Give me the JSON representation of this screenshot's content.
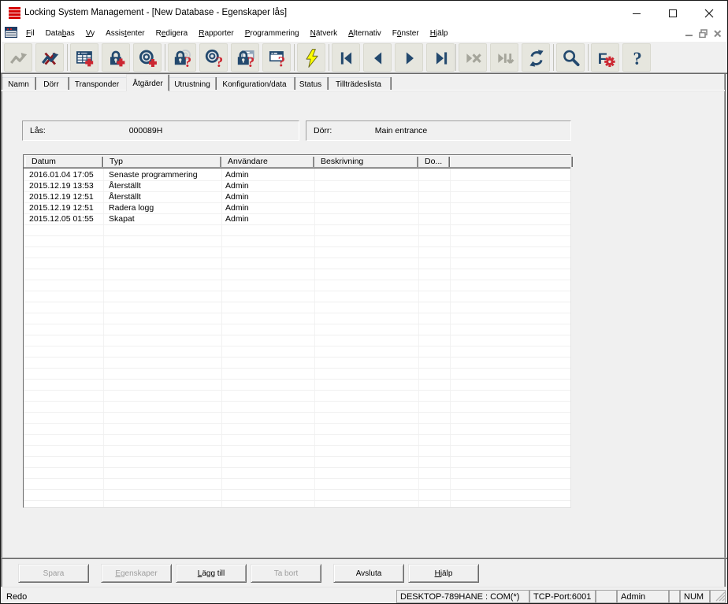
{
  "window": {
    "title": "Locking System Management - [New Database - Egenskaper lås]"
  },
  "menu": [
    {
      "label": "Fil",
      "u": 0
    },
    {
      "label": "Databas",
      "u": 4
    },
    {
      "label": "Vy",
      "u": 0
    },
    {
      "label": "Assistenter",
      "u": 5
    },
    {
      "label": "Redigera",
      "u": 1
    },
    {
      "label": "Rapporter",
      "u": 0
    },
    {
      "label": "Programmering",
      "u": 0
    },
    {
      "label": "Nätverk",
      "u": 0
    },
    {
      "label": "Alternativ",
      "u": 0
    },
    {
      "label": "Fönster",
      "u": 1
    },
    {
      "label": "Hjälp",
      "u": 0
    }
  ],
  "toolbar": [
    {
      "icon": "undo",
      "disabled": true
    },
    {
      "icon": "discard-changes",
      "disabled": false
    },
    {
      "icon": "add-table",
      "disabled": false
    },
    {
      "icon": "add-lock",
      "disabled": false
    },
    {
      "icon": "add-transponder",
      "disabled": false
    },
    {
      "icon": "read-lock",
      "disabled": false
    },
    {
      "icon": "read-transponder",
      "disabled": false
    },
    {
      "icon": "read-lock-data",
      "disabled": false
    },
    {
      "icon": "read-window",
      "disabled": false
    },
    {
      "icon": "program",
      "disabled": false
    },
    {
      "icon": "nav-first",
      "disabled": false
    },
    {
      "icon": "nav-prev",
      "disabled": false
    },
    {
      "icon": "nav-next",
      "disabled": false
    },
    {
      "icon": "nav-last",
      "disabled": false
    },
    {
      "icon": "nav-cancel",
      "disabled": true
    },
    {
      "icon": "nav-commit",
      "disabled": true
    },
    {
      "icon": "refresh",
      "disabled": false
    },
    {
      "icon": "search",
      "disabled": false
    },
    {
      "icon": "filter-settings",
      "disabled": false
    },
    {
      "icon": "help",
      "disabled": false
    }
  ],
  "tabs": {
    "items": [
      "Namn",
      "Dörr",
      "Transponder",
      "Åtgärder",
      "Utrustning",
      "Konfiguration/data",
      "Status",
      "Tillträdeslista"
    ],
    "active": "Åtgärder"
  },
  "fields": [
    {
      "label": "Lås:",
      "value": "000089H"
    },
    {
      "label": "Dörr:",
      "value": "Main entrance"
    }
  ],
  "table": {
    "columns": [
      "Datum",
      "Typ",
      "Användare",
      "Beskrivning",
      "Do...",
      ""
    ],
    "rows": [
      [
        "2016.01.04 17:05",
        "Senaste programmering",
        "Admin"
      ],
      [
        "2015.12.19 13:53",
        "Återställt",
        "Admin"
      ],
      [
        "2015.12.19 12:51",
        "Återställt",
        "Admin"
      ],
      [
        "2015.12.19 12:51",
        "Radera logg",
        "Admin"
      ],
      [
        "2015.12.05 01:55",
        "Skapat",
        "Admin"
      ]
    ]
  },
  "footer_buttons": [
    {
      "label": "Spara",
      "disabled": true
    },
    {
      "label": "Egenskaper",
      "disabled": true,
      "u": 0
    },
    {
      "label": "Lägg till",
      "disabled": false,
      "u": 0,
      "default": true
    },
    {
      "label": "Ta bort",
      "disabled": true
    },
    {
      "label": "Avsluta",
      "disabled": false
    },
    {
      "label": "Hjälp",
      "disabled": false,
      "u": 0
    }
  ],
  "statusbar": {
    "state": "Redo",
    "panes": [
      "DESKTOP-789HANE : COM(*)",
      "TCP-Port:6001",
      "",
      "Admin",
      "",
      "NUM",
      ""
    ]
  },
  "colors": {
    "navy": "#23496e",
    "red": "#cc2832",
    "disabled_gray": "#a5a59b",
    "toolbar_face": "#e6e6de"
  }
}
